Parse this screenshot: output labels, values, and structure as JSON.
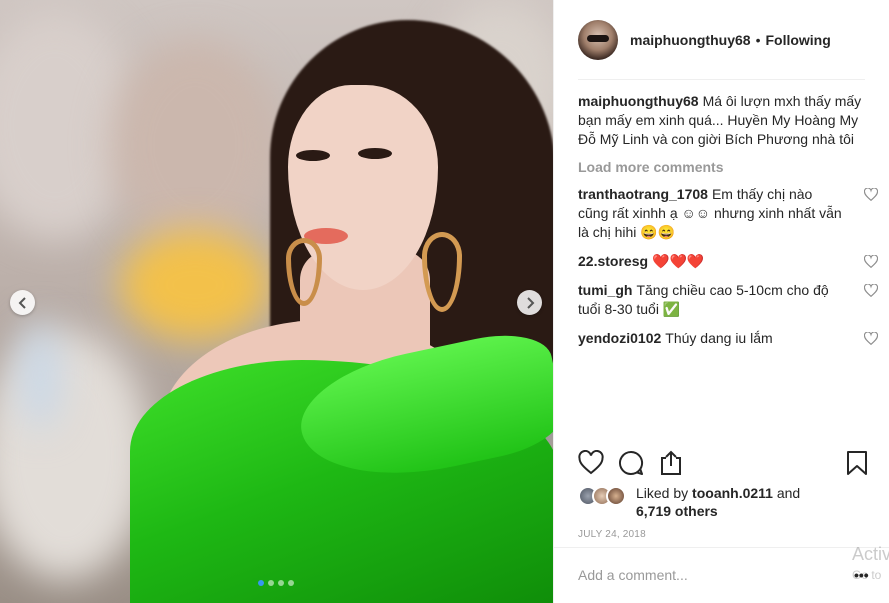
{
  "post": {
    "image_count": 4,
    "active_image": 1
  },
  "header": {
    "username": "maiphuongthuy68",
    "separator": "•",
    "follow_status": "Following"
  },
  "caption": {
    "username": "maiphuongthuy68",
    "text": "Má ôi lượn mxh thấy mấy bạn mấy em xinh quá... Huyền My Hoàng My Đỗ Mỹ Linh và con giời Bích Phương nhà tôi"
  },
  "load_more": "Load more comments",
  "comments": [
    {
      "username": "tranthaotrang_1708",
      "text": "Em thấy chị nào cũng rất xinhh ạ ☺☺ nhưng xinh nhất vẫn là chị hihi 😄😄"
    },
    {
      "username": "22.storesg",
      "text": "❤️❤️❤️"
    },
    {
      "username": "tumi_gh",
      "text": "Tăng chiều cao 5-10cm cho độ tuổi 8-30 tuổi ✅"
    },
    {
      "username": "yendozi0102",
      "text": "Thúy dang iu lắm"
    }
  ],
  "likes": {
    "prefix": "Liked by",
    "user": "tooanh.0211",
    "conj": "and",
    "count": "6,719 others"
  },
  "date": "JULY 24, 2018",
  "add_comment_placeholder": "Add a comment...",
  "more_label": "•••",
  "watermark": {
    "line1": "Activ",
    "line2": "Go to"
  },
  "icons": {
    "prev": "chevron-left-icon",
    "next": "chevron-right-icon",
    "like": "heart-icon",
    "comment": "speech-bubble-icon",
    "share": "share-icon",
    "save": "bookmark-icon"
  },
  "colors": {
    "accent": "#3897f0",
    "text": "#262626",
    "muted": "#999999",
    "dress": "#1eb814"
  }
}
